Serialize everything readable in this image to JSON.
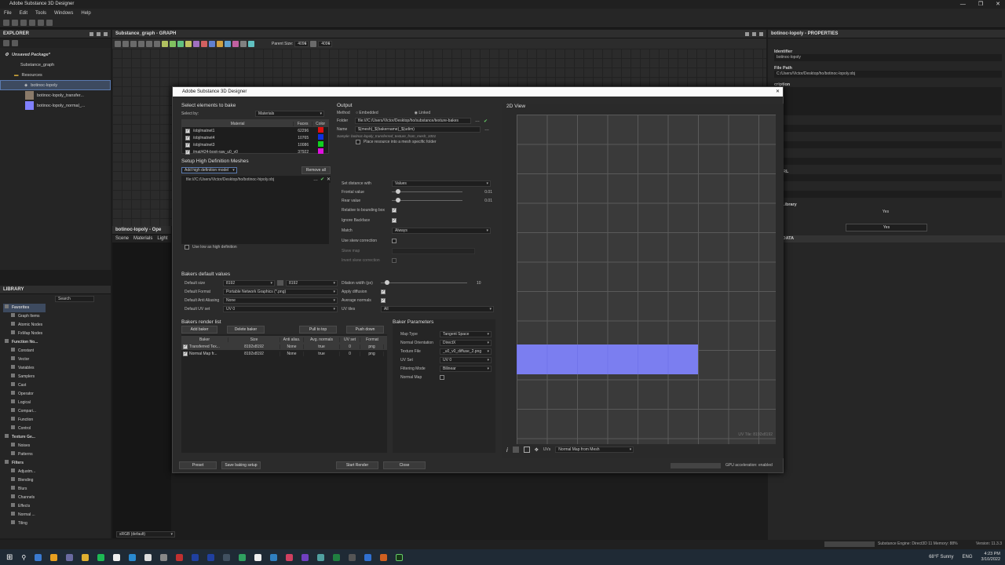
{
  "app": {
    "title": "Adobe Substance 3D Designer"
  },
  "menu": [
    "File",
    "Edit",
    "Tools",
    "Windows",
    "Help"
  ],
  "explorer": {
    "title": "EXPLORER",
    "package": "Unsaved Package*",
    "graph": "Substance_graph",
    "resources": "Resources",
    "items": [
      "botinoc-lopoly",
      "botinoc-lopoly_transfer...",
      "botinoc-lopoly_normal_..."
    ]
  },
  "graph": {
    "title": "Substance_graph - GRAPH",
    "parent_size_label": "Parent Size:",
    "size1": "4096",
    "size2": "4096"
  },
  "opener": {
    "title": "botinoc-lopoly - Ope",
    "tabs": [
      "Scene",
      "Materials",
      "Light"
    ]
  },
  "library": {
    "title": "LIBRARY",
    "search": "Search",
    "items": [
      "Favorites",
      "Graph Items",
      "Atomic Nodes",
      "FxMap Nodes",
      "Function No...",
      "Constant",
      "Vector",
      "Variables",
      "Samplers",
      "Cast",
      "Operator",
      "Logical",
      "Compari...",
      "Function",
      "Control",
      "Texture Ge...",
      "Noises",
      "Patterns",
      "Filters",
      "Adjustm...",
      "Blending",
      "Blurs",
      "Channels",
      "Effects",
      "Normal ...",
      "Tiling"
    ],
    "colorspace": "sRGB (default)"
  },
  "props": {
    "title": "botinoc-lopoly - PROPERTIES",
    "identifier_label": "Identifier",
    "identifier": "botinoc-lopoly",
    "filepath_label": "File Path",
    "filepath": "C:/Users/Victor/Desktop/ho/botinoc-lopoly.obj",
    "frag": [
      "cription",
      "gory",
      "l",
      "or",
      "or URL",
      "Data",
      "r In Library",
      "ion"
    ],
    "yes1": "Yes",
    "yes2": "Yes",
    "metadata": "ETADATA"
  },
  "dialog": {
    "title": "Adobe Substance 3D Designer",
    "select_header": "Select elements to bake",
    "select_by_label": "Select by:",
    "select_by": "Materials",
    "mat_cols": [
      "Material",
      "Faces",
      "Color"
    ],
    "materials": [
      {
        "name": "/obj/matnet1",
        "faces": "62296",
        "color": "#e01010"
      },
      {
        "name": "/obj/matnet4",
        "faces": "10765",
        "color": "#1030e0"
      },
      {
        "name": "/obj/matnet3",
        "faces": "10086",
        "color": "#10d020"
      },
      {
        "name": "/mat/424-boot-raw_u0_v0",
        "faces": "37922",
        "color": "#e010e0"
      }
    ],
    "hd_header": "Setup High Definition Meshes",
    "add_hd": "Add high definition model",
    "remove_all": "Remove all",
    "hd_file": "file:///C:/Users/Victor/Desktop/ho/botinoc-hipoly.obj",
    "use_low": "Use low as high definition",
    "set_distance_label": "Set distance with",
    "set_distance": "Values",
    "frontal_label": "Frontal value",
    "frontal": "0.01",
    "rear_label": "Rear value",
    "rear": "0.01",
    "relative_label": "Relative to bounding box",
    "ignore_label": "Ignore Backface",
    "match_label": "Match",
    "match": "Always",
    "skew_label": "Use skew correction",
    "skew_map_label": "Skew map",
    "invert_skew_label": "Invert skew correction",
    "output_header": "Output",
    "method_label": "Method",
    "embedded": "Embedded",
    "linked": "Linked",
    "folder_label": "Folder",
    "folder": "file:///C:/Users/Victor/Desktop/ho/substance/texture-bakes",
    "name_label": "Name",
    "name": "$(mesh)_$(bakername)_$(udim)",
    "sample": "Sample: botinoc-lopoly_transferred_texture_from_mesh_1001",
    "place_res": "Place resource into a mesh specific folder",
    "bakers_default_header": "Bakers default values",
    "def_size_label": "Default size",
    "size_a": "8192",
    "size_b": "8192",
    "def_format_label": "Default Format",
    "def_format": "Portable Network Graphics (*.png)",
    "def_aa_label": "Default Anti Aliasing",
    "def_aa": "None",
    "def_uv_label": "Default UV set",
    "def_uv": "UV 0",
    "dilation_label": "Dilation width (px)",
    "dilation": "10",
    "apply_diff_label": "Apply diffusion",
    "avg_normals_label": "Average normals",
    "uv_tiles_label": "UV tiles",
    "uv_tiles": "All",
    "render_list_header": "Bakers render list",
    "add_baker": "Add baker",
    "delete_baker": "Delete baker",
    "pull_top": "Pull to top",
    "push_down": "Push down",
    "list_cols": [
      "Baker",
      "Size",
      "Anti alias.",
      "Avg. normals",
      "UV set",
      "Format"
    ],
    "bakers": [
      {
        "name": "Transferred Tex...",
        "size": "8192x8192",
        "aa": "None",
        "avg": "true",
        "uv": "0",
        "fmt": "png"
      },
      {
        "name": "Normal Map fr...",
        "size": "8192x8192",
        "aa": "None",
        "avg": "true",
        "uv": "0",
        "fmt": "png"
      }
    ],
    "params_header": "Baker Parameters",
    "params": [
      {
        "label": "Map Type",
        "value": "Tangent Space"
      },
      {
        "label": "Normal Orientation",
        "value": "DirectX"
      },
      {
        "label": "Texture File",
        "value": "_u0_v0_diffuse_2.png"
      },
      {
        "label": "UV Set",
        "value": "UV 0"
      },
      {
        "label": "Filtering Mode",
        "value": "Bilinear"
      }
    ],
    "normal_map_label": "Normal Map",
    "view_title": "2D View",
    "uv_tile": "UV Tile: 8192x8192",
    "uvs_label": "UVs",
    "uvs_value": "Normal Map from Mesh",
    "preset": "Preset",
    "save_setup": "Save baking setup",
    "start_render": "Start Render",
    "close": "Close",
    "gpu": "GPU acceleration: enabled"
  },
  "status": {
    "engine": "Substance Engine: Direct3D 11 Memory: 88%",
    "version": "Version: 11.3.3"
  },
  "taskbar": {
    "weather": "68°F  Sunny",
    "lang": "ENG",
    "time": "4:23 PM",
    "date": "3/10/2022"
  }
}
